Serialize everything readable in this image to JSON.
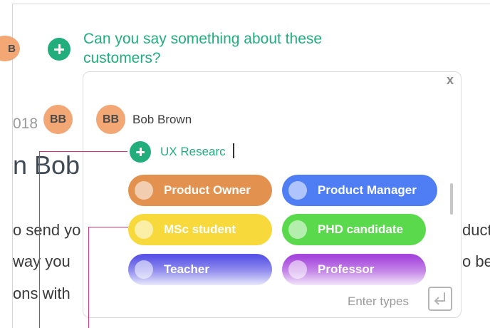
{
  "question": {
    "text_line1": "Can you say something about these",
    "text_line2": "customers?"
  },
  "background": {
    "top_avatar_initials": "B",
    "date_fragment": "018",
    "row_avatar_initials": "BB",
    "heading_fragment": "n Bob",
    "body_left": [
      "o send yo",
      "way you",
      "ons with"
    ],
    "body_right": [
      "duct",
      "o be"
    ]
  },
  "popup": {
    "close_label": "x",
    "user": {
      "initials": "BB",
      "name": "Bob Brown"
    },
    "input_value": "UX Researc",
    "chips": [
      {
        "label": "Product Owner",
        "color": "#e2914e"
      },
      {
        "label": "Product Manager",
        "color": "#4f7df3"
      },
      {
        "label": "MSc student",
        "color": "#f7d93b"
      },
      {
        "label": "PHD candidate",
        "color": "#59d94b"
      },
      {
        "label": "Teacher",
        "color": "#5a55e6"
      },
      {
        "label": "Professor",
        "color": "#a546dc"
      }
    ],
    "enter_hint": "Enter types"
  },
  "colors": {
    "accent_green": "#22ad7c",
    "avatar_orange": "#f2a774",
    "annotation_pink": "#d9306e"
  }
}
